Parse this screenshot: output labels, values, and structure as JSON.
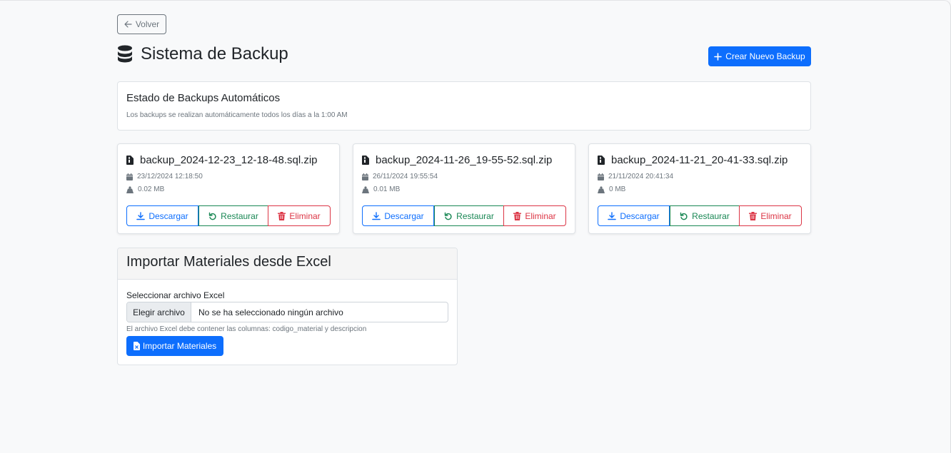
{
  "back_button": {
    "label": "Volver",
    "icon": "arrow-left-icon"
  },
  "page": {
    "title": "Sistema de Backup",
    "title_icon": "database-icon"
  },
  "create_button": {
    "label": "Crear Nuevo Backup",
    "icon": "plus-icon"
  },
  "status": {
    "title": "Estado de Backups Automáticos",
    "subtitle": "Los backups se realizan automáticamente todos los días a la 1:00 AM"
  },
  "backups": [
    {
      "filename": "backup_2024-12-23_12-18-48.sql.zip",
      "date": "23/12/2024 12:18:50",
      "size": "0.02 MB"
    },
    {
      "filename": "backup_2024-11-26_19-55-52.sql.zip",
      "date": "26/11/2024 19:55:54",
      "size": "0.01 MB"
    },
    {
      "filename": "backup_2024-11-21_20-41-33.sql.zip",
      "date": "21/11/2024 20:41:34",
      "size": "0 MB"
    }
  ],
  "backup_actions": {
    "download": "Descargar",
    "restore": "Restaurar",
    "delete": "Eliminar"
  },
  "import": {
    "title": "Importar Materiales desde Excel",
    "file_label": "Seleccionar archivo Excel",
    "choose_button": "Elegir archivo",
    "no_file": "No se ha seleccionado ningún archivo",
    "help": "El archivo Excel debe contener las columnas: codigo_material y descripcion",
    "submit": "Importar Materiales"
  },
  "colors": {
    "primary": "#0d6efd",
    "success": "#198754",
    "danger": "#dc3545",
    "secondary": "#6c757d"
  }
}
